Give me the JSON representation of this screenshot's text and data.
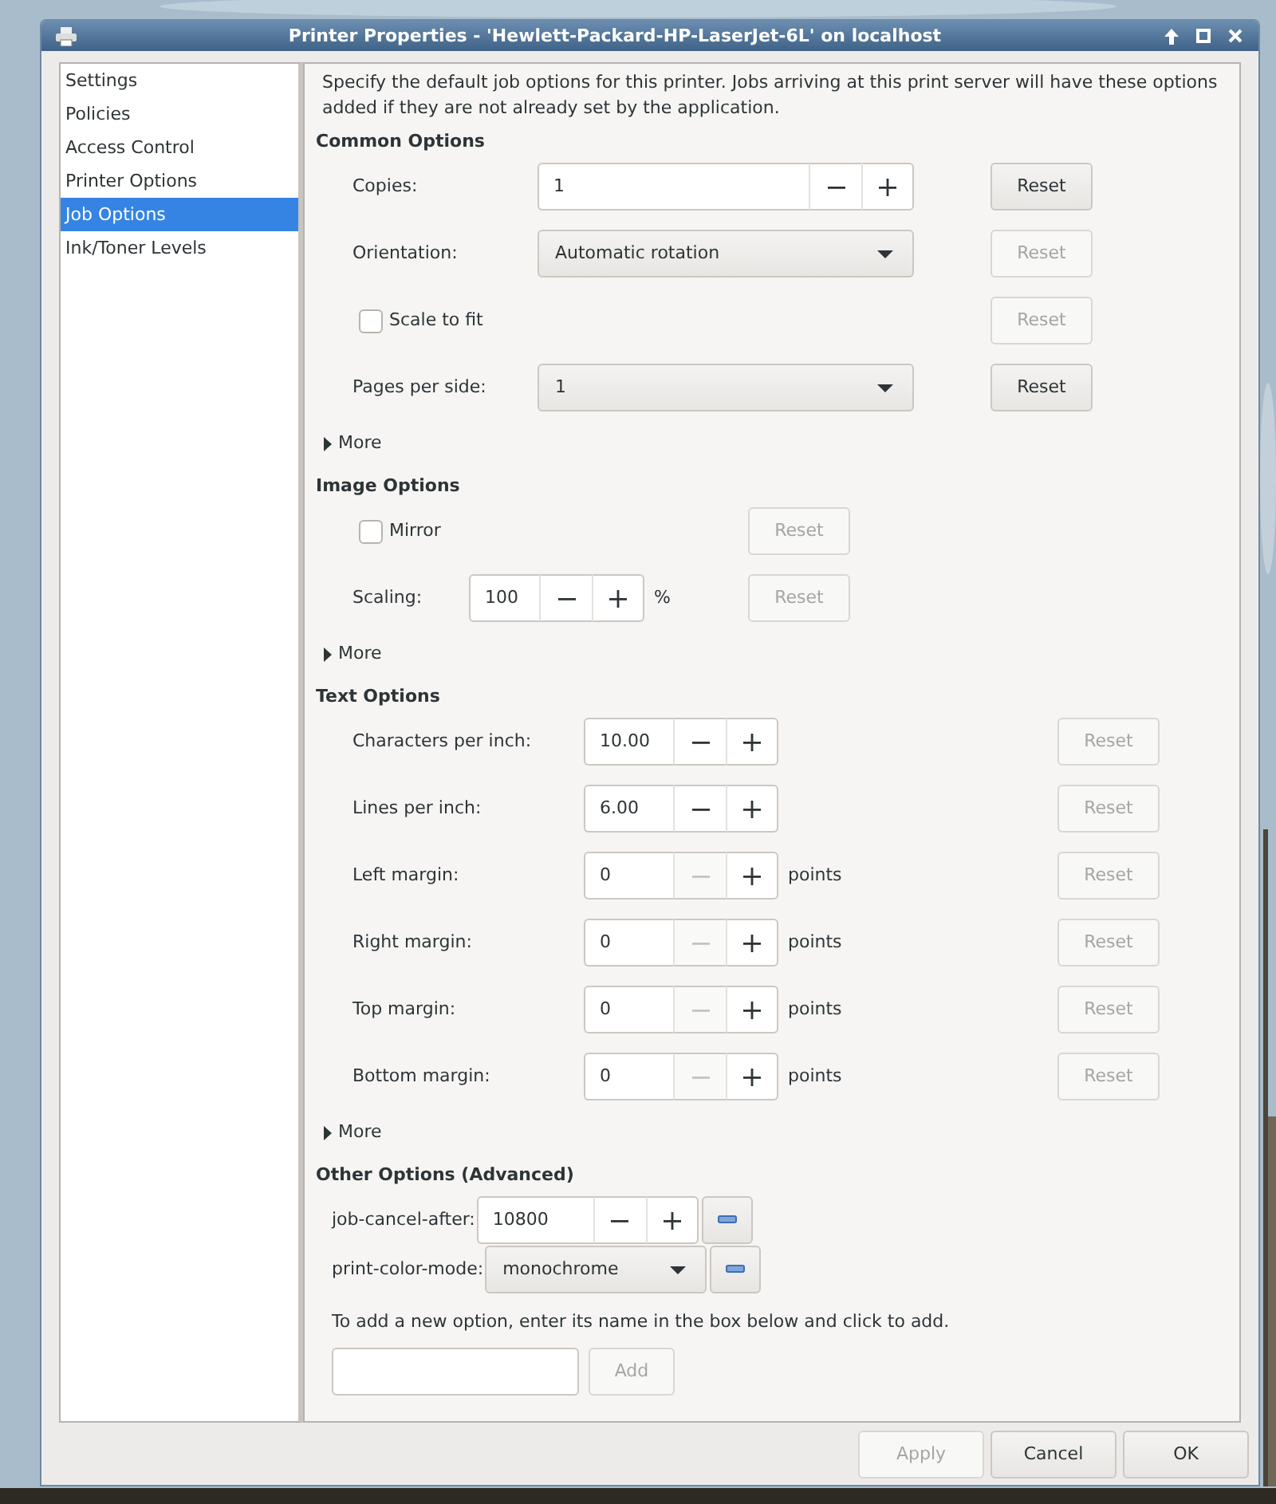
{
  "window": {
    "title": "Printer Properties - 'Hewlett-Packard-HP-LaserJet-6L' on localhost"
  },
  "sidebar": {
    "items": [
      {
        "label": "Settings",
        "selected": false
      },
      {
        "label": "Policies",
        "selected": false
      },
      {
        "label": "Access Control",
        "selected": false
      },
      {
        "label": "Printer Options",
        "selected": false
      },
      {
        "label": "Job Options",
        "selected": true
      },
      {
        "label": "Ink/Toner Levels",
        "selected": false
      }
    ]
  },
  "description": "Specify the default job options for this printer.  Jobs arriving at this print server will have these options added if they are not already set by the application.",
  "sections": [
    {
      "title": "Common Options",
      "rows": [
        {
          "kind": "spin",
          "label": "Copies:",
          "value": "1",
          "minus_disabled": false,
          "reset": {
            "label": "Reset",
            "disabled": false
          }
        },
        {
          "kind": "combo",
          "label": "Orientation:",
          "value": "Automatic rotation",
          "reset": {
            "label": "Reset",
            "disabled": true
          }
        },
        {
          "kind": "check",
          "label": "Scale to fit",
          "checked": false,
          "reset": {
            "label": "Reset",
            "disabled": true
          }
        },
        {
          "kind": "combo",
          "label": "Pages per side:",
          "value": "1",
          "reset": {
            "label": "Reset",
            "disabled": false
          }
        }
      ],
      "more": {
        "label": "More",
        "expanded": false
      }
    },
    {
      "title": "Image Options",
      "rows": [
        {
          "kind": "check",
          "label": "Mirror",
          "checked": false,
          "reset": {
            "label": "Reset",
            "disabled": true
          }
        },
        {
          "kind": "spin",
          "label": "Scaling:",
          "value": "100",
          "minus_disabled": false,
          "unit": "%",
          "reset": {
            "label": "Reset",
            "disabled": true
          }
        }
      ],
      "more": {
        "label": "More",
        "expanded": false
      }
    },
    {
      "title": "Text Options",
      "rows": [
        {
          "kind": "spin",
          "label": "Characters per inch:",
          "value": "10.00",
          "minus_disabled": false,
          "reset": {
            "label": "Reset",
            "disabled": true
          }
        },
        {
          "kind": "spin",
          "label": "Lines per inch:",
          "value": "6.00",
          "minus_disabled": false,
          "reset": {
            "label": "Reset",
            "disabled": true
          }
        },
        {
          "kind": "spin",
          "label": "Left margin:",
          "value": "0",
          "minus_disabled": true,
          "unit": "points",
          "reset": {
            "label": "Reset",
            "disabled": true
          }
        },
        {
          "kind": "spin",
          "label": "Right margin:",
          "value": "0",
          "minus_disabled": true,
          "unit": "points",
          "reset": {
            "label": "Reset",
            "disabled": true
          }
        },
        {
          "kind": "spin",
          "label": "Top margin:",
          "value": "0",
          "minus_disabled": true,
          "unit": "points",
          "reset": {
            "label": "Reset",
            "disabled": true
          }
        },
        {
          "kind": "spin",
          "label": "Bottom margin:",
          "value": "0",
          "minus_disabled": true,
          "unit": "points",
          "reset": {
            "label": "Reset",
            "disabled": true
          }
        }
      ],
      "more": {
        "label": "More",
        "expanded": false
      }
    }
  ],
  "other_options": {
    "title": "Other Options (Advanced)",
    "rows": [
      {
        "kind": "spin",
        "label": "job-cancel-after:",
        "value": "10800",
        "minus_disabled": false
      },
      {
        "kind": "combo",
        "label": "print-color-mode:",
        "value": "monochrome"
      }
    ],
    "hint": "To add a new option, enter its name in the box below and click to add.",
    "add_button": {
      "label": "Add",
      "disabled": true
    }
  },
  "buttons": [
    {
      "label": "Apply",
      "disabled": true
    },
    {
      "label": "Cancel",
      "disabled": false
    },
    {
      "label": "OK",
      "disabled": false
    }
  ]
}
